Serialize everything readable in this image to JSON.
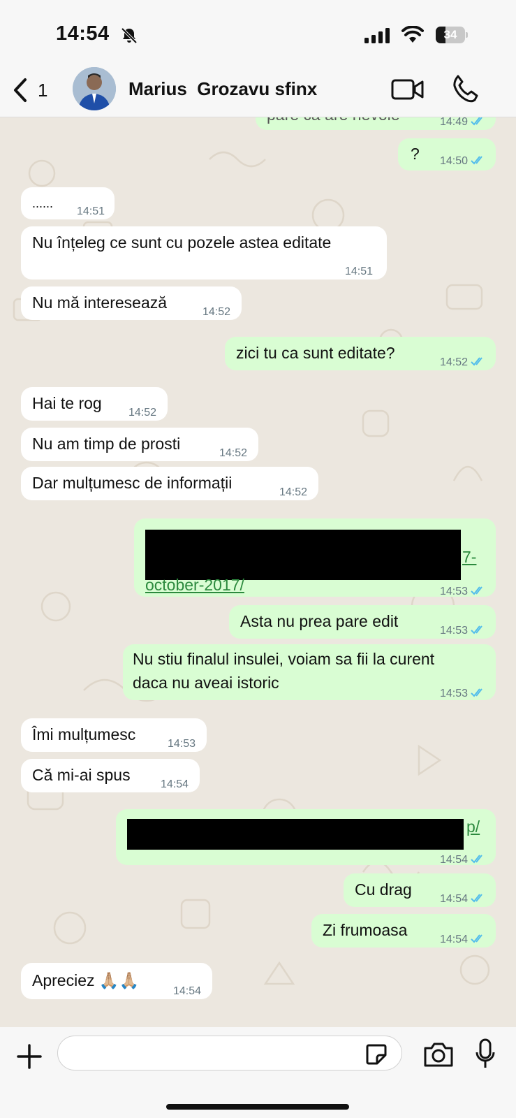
{
  "status_bar": {
    "time": "14:54",
    "battery": "34",
    "battery_level": 0.34
  },
  "header": {
    "back_count": "1",
    "contact_name": "Marius  Grozavu sfinx"
  },
  "messages": [
    {
      "dir": "out",
      "text": "pare ca are nevoie",
      "time": "14:49"
    },
    {
      "dir": "out",
      "text": "?",
      "time": "14:50"
    },
    {
      "dir": "in",
      "text": "......",
      "time": "14:51"
    },
    {
      "dir": "in",
      "text": "Nu înțeleg ce sunt cu pozele astea editate",
      "time": "14:51"
    },
    {
      "dir": "in",
      "text": "Nu mă interesează",
      "time": "14:52"
    },
    {
      "dir": "out",
      "text": "zici tu ca sunt editate?",
      "time": "14:52"
    },
    {
      "dir": "in",
      "text": "Hai te rog",
      "time": "14:52"
    },
    {
      "dir": "in",
      "text": "Nu am timp de prosti",
      "time": "14:52"
    },
    {
      "dir": "in",
      "text": "Dar mulțumesc de informații",
      "time": "14:52"
    },
    {
      "dir": "out",
      "link_tail": "7-",
      "link_last": "october-2017/",
      "time": "14:53"
    },
    {
      "dir": "out",
      "text": "Asta nu prea pare edit",
      "time": "14:53"
    },
    {
      "dir": "out",
      "line1": "Nu stiu finalul insulei, voiam sa fii la curent",
      "line2": "daca nu aveai istoric",
      "time": "14:53"
    },
    {
      "dir": "in",
      "text": "Îmi mulțumesc",
      "time": "14:53"
    },
    {
      "dir": "in",
      "text": "Că mi-ai spus",
      "time": "14:54"
    },
    {
      "dir": "out",
      "link_tail": "p/",
      "time": "14:54"
    },
    {
      "dir": "out",
      "text": "Cu drag",
      "time": "14:54"
    },
    {
      "dir": "out",
      "text": "Zi frumoasa",
      "time": "14:54"
    },
    {
      "dir": "in",
      "text": "Apreciez 🙏🏼🙏🏼",
      "time": "14:54"
    }
  ],
  "input": {
    "placeholder": ""
  },
  "colors": {
    "incoming": "#ffffff",
    "outgoing": "#d9fdd3",
    "read_ticks": "#53bdeb",
    "wallpaper": "#ece7df"
  }
}
